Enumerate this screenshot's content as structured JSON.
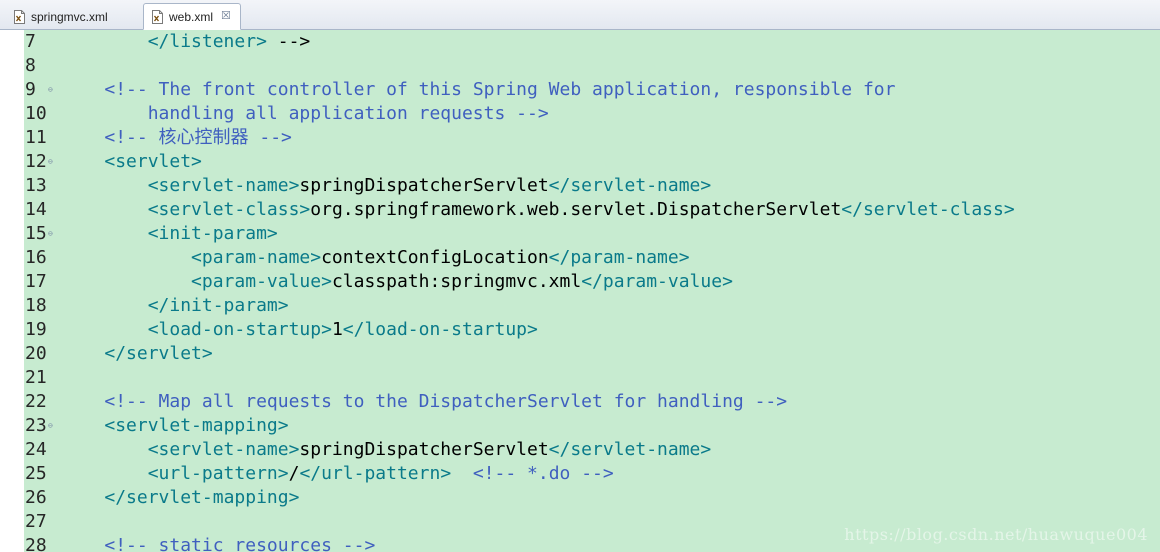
{
  "tabs": [
    {
      "label": "springmvc.xml",
      "active": false,
      "icon": "xml-file-icon"
    },
    {
      "label": "web.xml",
      "active": true,
      "icon": "xml-file-icon",
      "close": "☒"
    }
  ],
  "colors": {
    "editor_background": "#c7ebd0",
    "tag": "#0a7a8a",
    "comment": "#3f5fbf",
    "text": "#000000"
  },
  "editor": {
    "lines": [
      {
        "n": "7",
        "fold": "",
        "code": "        </listener> -->"
      },
      {
        "n": "8",
        "fold": "",
        "code": ""
      },
      {
        "n": "9",
        "fold": "⊖",
        "code": "    <!-- The front controller of this Spring Web application, responsible for"
      },
      {
        "n": "10",
        "fold": "",
        "code": "        handling all application requests -->"
      },
      {
        "n": "11",
        "fold": "",
        "code": "    <!-- 核心控制器 -->"
      },
      {
        "n": "12",
        "fold": "⊖",
        "code": "    <servlet>"
      },
      {
        "n": "13",
        "fold": "",
        "code": "        <servlet-name>springDispatcherServlet</servlet-name>"
      },
      {
        "n": "14",
        "fold": "",
        "code": "        <servlet-class>org.springframework.web.servlet.DispatcherServlet</servlet-class>"
      },
      {
        "n": "15",
        "fold": "⊖",
        "code": "        <init-param>"
      },
      {
        "n": "16",
        "fold": "",
        "code": "            <param-name>contextConfigLocation</param-name>"
      },
      {
        "n": "17",
        "fold": "",
        "code": "            <param-value>classpath:springmvc.xml</param-value>"
      },
      {
        "n": "18",
        "fold": "",
        "code": "        </init-param>"
      },
      {
        "n": "19",
        "fold": "",
        "code": "        <load-on-startup>1</load-on-startup>"
      },
      {
        "n": "20",
        "fold": "",
        "code": "    </servlet>"
      },
      {
        "n": "21",
        "fold": "",
        "code": ""
      },
      {
        "n": "22",
        "fold": "",
        "code": "    <!-- Map all requests to the DispatcherServlet for handling -->"
      },
      {
        "n": "23",
        "fold": "⊖",
        "code": "    <servlet-mapping>"
      },
      {
        "n": "24",
        "fold": "",
        "code": "        <servlet-name>springDispatcherServlet</servlet-name>"
      },
      {
        "n": "25",
        "fold": "",
        "code": "        <url-pattern>/</url-pattern>  <!-- *.do -->"
      },
      {
        "n": "26",
        "fold": "",
        "code": "    </servlet-mapping>"
      },
      {
        "n": "27",
        "fold": "",
        "code": ""
      },
      {
        "n": "28",
        "fold": "",
        "code": "    <!-- static resources -->"
      }
    ]
  },
  "watermark": "https://blog.csdn.net/huawuque004"
}
